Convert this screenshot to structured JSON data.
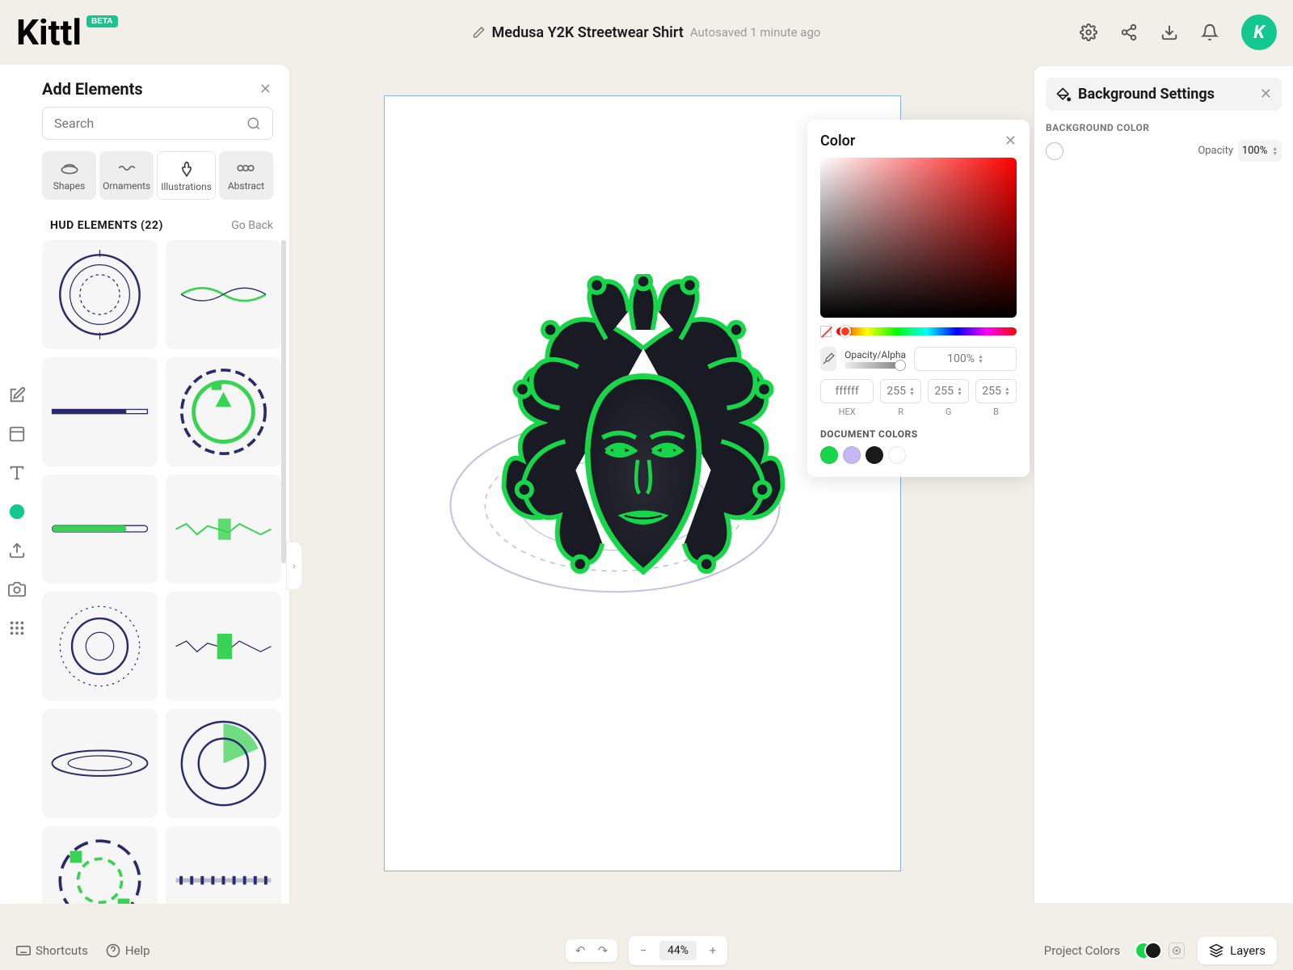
{
  "header": {
    "logo": "Kittl",
    "beta": "BETA",
    "doc_title": "Medusa Y2K Streetwear Shirt",
    "autosave": "Autosaved 1 minute ago",
    "avatar_letter": "K"
  },
  "left_panel": {
    "title": "Add Elements",
    "search_placeholder": "Search",
    "tabs": [
      {
        "label": "Shapes"
      },
      {
        "label": "Ornaments"
      },
      {
        "label": "Illustrations"
      },
      {
        "label": "Abstract"
      }
    ],
    "section_title": "HUD ELEMENTS (22)",
    "go_back": "Go Back"
  },
  "color_popup": {
    "title": "Color",
    "opacity_label": "Opacity/Alpha",
    "opacity_value": "100%",
    "hex": {
      "label": "HEX",
      "value": "ffffff"
    },
    "r": {
      "label": "R",
      "value": "255"
    },
    "g": {
      "label": "G",
      "value": "255"
    },
    "b": {
      "label": "B",
      "value": "255"
    },
    "doc_colors_label": "DOCUMENT COLORS",
    "swatches": [
      "#18d64a",
      "#c7b8f5",
      "#1a1a1a",
      "#ffffff"
    ]
  },
  "right_panel": {
    "title": "Background Settings",
    "section": "BACKGROUND COLOR",
    "opacity_label": "Opacity",
    "opacity_value": "100%"
  },
  "bottom": {
    "shortcuts": "Shortcuts",
    "help": "Help",
    "zoom": "44%",
    "project_colors": "Project Colors",
    "layers": "Layers"
  }
}
